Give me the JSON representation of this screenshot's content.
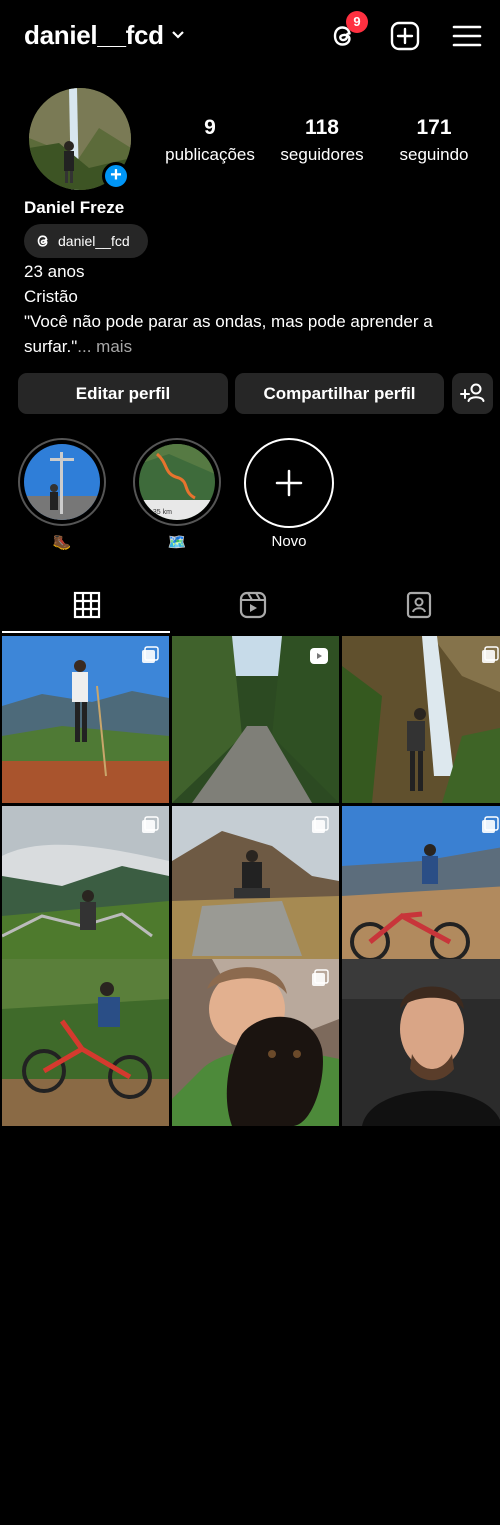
{
  "header": {
    "username": "daniel__fcd",
    "threads_badge": "9",
    "icons": [
      "chevron-down-icon",
      "threads-icon",
      "add-post-icon",
      "menu-icon"
    ]
  },
  "profile": {
    "full_name": "Daniel Freze",
    "threads_handle": "daniel__fcd",
    "stats": [
      {
        "count": "9",
        "label": "publicações"
      },
      {
        "count": "118",
        "label": "seguidores"
      },
      {
        "count": "171",
        "label": "seguindo"
      }
    ],
    "bio": {
      "line1": "23 anos",
      "line2": "Cristão",
      "line3": "\"Você não pode parar as ondas, mas pode aprender a",
      "line4": "surfar.\"",
      "more": "... mais"
    }
  },
  "actions": {
    "edit": "Editar perfil",
    "share": "Compartilhar perfil",
    "discover_icon": "add-person-icon"
  },
  "highlights": [
    {
      "caption": "🥾",
      "icon": "hiking-boot-emoji"
    },
    {
      "caption": "🗺️",
      "icon": "map-emoji"
    },
    {
      "caption": "Novo",
      "icon": "plus-icon"
    }
  ],
  "tabs": [
    "grid-icon",
    "reels-icon",
    "tagged-icon"
  ],
  "grid": [
    {
      "desc": "mountain-hiker",
      "badge": "carousel-icon"
    },
    {
      "desc": "forest-road",
      "badge": "reel-icon"
    },
    {
      "desc": "waterfall-hiker",
      "badge": "carousel-icon"
    },
    {
      "desc": "cloudy-valley",
      "badge": "carousel-icon"
    },
    {
      "desc": "rock-sitting",
      "badge": "carousel-icon"
    },
    {
      "desc": "bike-rock",
      "badge": "carousel-icon"
    },
    {
      "desc": "bike-trail",
      "badge": ""
    },
    {
      "desc": "boy-dog",
      "badge": "carousel-icon"
    },
    {
      "desc": "selfie",
      "badge": ""
    }
  ],
  "colors": {
    "background": "#000000",
    "button": "#262626",
    "badge": "#ff3040",
    "accent": "#0095f6",
    "muted": "#a8a8a8"
  }
}
